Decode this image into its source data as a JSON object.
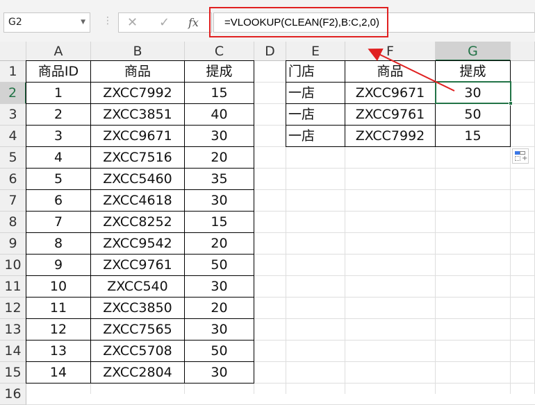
{
  "name_box": "G2",
  "formula": "=VLOOKUP(CLEAN(F2),B:C,2,0)",
  "icons": {
    "cancel": "✕",
    "confirm": "✓",
    "fx": "fx"
  },
  "columns": [
    "A",
    "B",
    "C",
    "D",
    "E",
    "F",
    "G"
  ],
  "rows": [
    "1",
    "2",
    "3",
    "4",
    "5",
    "6",
    "7",
    "8",
    "9",
    "10",
    "11",
    "12",
    "13",
    "14",
    "15",
    "16"
  ],
  "left_table": {
    "headers": [
      "商品ID",
      "商品",
      "提成"
    ],
    "rows": [
      [
        "1",
        "ZXCC7992",
        "15"
      ],
      [
        "2",
        "ZXCC3851",
        "40"
      ],
      [
        "3",
        "ZXCC9671",
        "30"
      ],
      [
        "4",
        "ZXCC7516",
        "20"
      ],
      [
        "5",
        "ZXCC5460",
        "35"
      ],
      [
        "6",
        "ZXCC4618",
        "30"
      ],
      [
        "7",
        "ZXCC8252",
        "15"
      ],
      [
        "8",
        "ZXCC9542",
        "20"
      ],
      [
        "9",
        "ZXCC9761",
        "50"
      ],
      [
        "10",
        "ZXCC540",
        "30"
      ],
      [
        "11",
        "ZXCC3850",
        "20"
      ],
      [
        "12",
        "ZXCC7565",
        "30"
      ],
      [
        "13",
        "ZXCC5708",
        "50"
      ],
      [
        "14",
        "ZXCC2804",
        "30"
      ]
    ]
  },
  "right_table": {
    "headers": [
      "门店",
      "商品",
      "提成"
    ],
    "rows": [
      [
        "一店",
        "ZXCC9671",
        "30"
      ],
      [
        "一店",
        "ZXCC9761",
        "50"
      ],
      [
        "一店",
        "ZXCC7992",
        "15"
      ]
    ]
  },
  "colors": {
    "accent": "#217346",
    "annotation": "#e02020"
  }
}
